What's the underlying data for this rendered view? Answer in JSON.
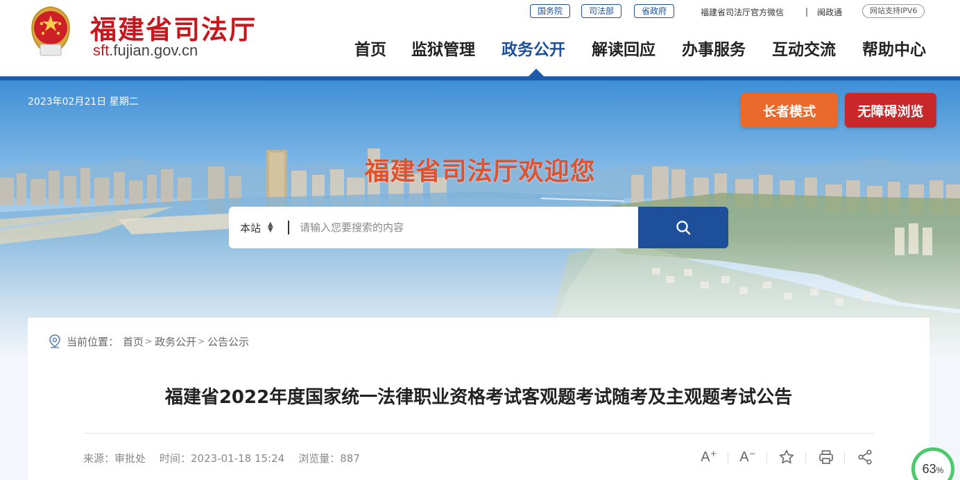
{
  "header": {
    "logo_title": "福建省司法厅",
    "logo_domain_prefix": "sft",
    "logo_domain_rest": ".fujian.gov.cn",
    "emblem_text": "中国司法",
    "top_links": {
      "guowuyuan": "国务院",
      "sifabu": "司法部",
      "shengzhengfu": "省政府",
      "wechat": "福建省司法厅官方微信",
      "separator": "|",
      "minzhengtong": "闽政通",
      "ipv6": "网站支持IPV6"
    },
    "nav": [
      {
        "label": "首页"
      },
      {
        "label": "监狱管理"
      },
      {
        "label": "政务公开"
      },
      {
        "label": "解读回应"
      },
      {
        "label": "办事服务"
      },
      {
        "label": "互动交流"
      },
      {
        "label": "帮助中心"
      }
    ],
    "active_nav": "政务公开"
  },
  "banner": {
    "date": "2023年02月21日 星期二",
    "elder_mode": "长者模式",
    "accessible": "无障碍浏览",
    "welcome": "福建省司法厅欢迎您"
  },
  "search": {
    "scope": "本站",
    "placeholder": "请输入您要搜索的内容",
    "icon": "search-icon"
  },
  "breadcrumb": {
    "prefix": "当前位置：",
    "items": [
      "首页",
      "政务公开",
      "公告公示"
    ],
    "sep": ">"
  },
  "article": {
    "title": "福建省2022年度国家统一法律职业资格考试客观题考试随考及主观题考试公告",
    "source": "来源：审批处",
    "time": "时间：2023-01-18 15:24",
    "views": "浏览量：887"
  },
  "tools": {
    "font_larger": "A",
    "font_smaller": "A",
    "icons": [
      "font-increase-icon",
      "font-decrease-icon",
      "star-icon",
      "print-icon",
      "share-icon"
    ]
  },
  "progress": {
    "value": "63",
    "unit": "%"
  },
  "colors": {
    "brand_red": "#c8161d",
    "brand_blue": "#1e4f9b",
    "elder_orange": "#ea6a2c",
    "access_red": "#c8282a",
    "welcome_orange": "#e0522d",
    "progress_green": "#4cc96a"
  }
}
